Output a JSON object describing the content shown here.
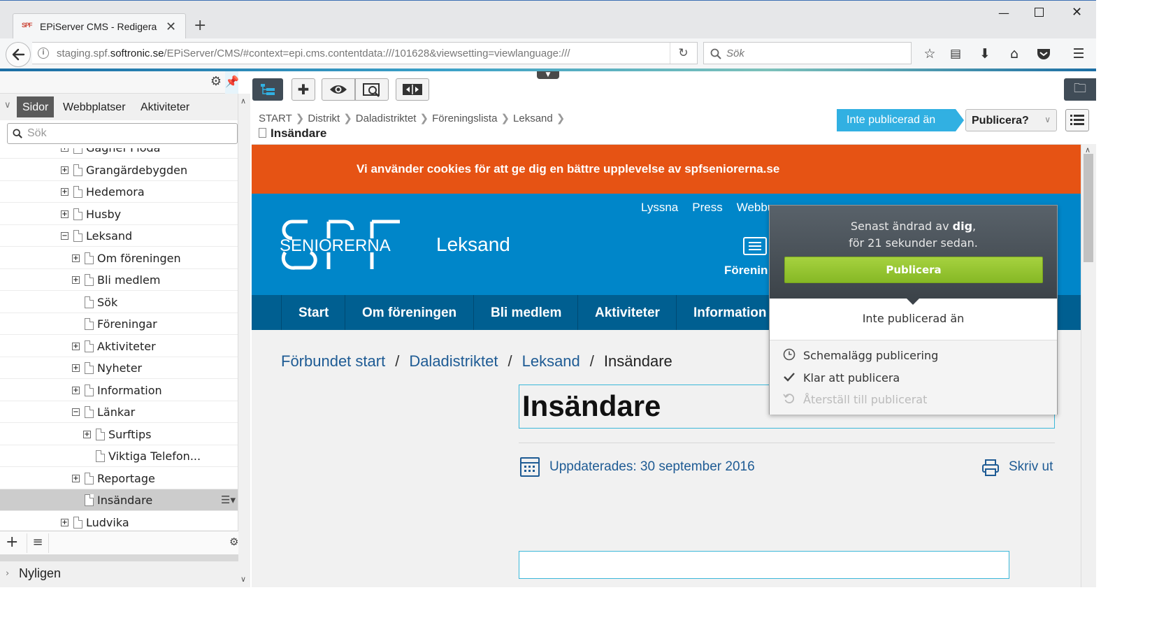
{
  "browser": {
    "tab_title": "EPiServer CMS - Redigera",
    "tab_favicon_text": "SPF",
    "url_host_prefix": "staging.spf.",
    "url_host_main": "softronic.se",
    "url_path": "/EPiServer/CMS/#context=epi.cms.contentdata:///101628&viewsetting=viewlanguage:///",
    "search_placeholder": "Sök"
  },
  "left_pane": {
    "tabs": [
      "Sidor",
      "Webbplatser",
      "Aktiviteter"
    ],
    "active_tab": "Sidor",
    "search_placeholder": "Sök",
    "tree": [
      {
        "label": "Gagnef Floda",
        "level": 0,
        "expander": "+"
      },
      {
        "label": "Grangärdebygden",
        "level": 0,
        "expander": "+"
      },
      {
        "label": "Hedemora",
        "level": 0,
        "expander": "+"
      },
      {
        "label": "Husby",
        "level": 0,
        "expander": "+"
      },
      {
        "label": "Leksand",
        "level": 0,
        "expander": "−"
      },
      {
        "label": "Om föreningen",
        "level": 1,
        "expander": "+"
      },
      {
        "label": "Bli medlem",
        "level": 1,
        "expander": "+"
      },
      {
        "label": "Sök",
        "level": 1,
        "expander": ""
      },
      {
        "label": "Föreningar",
        "level": 1,
        "expander": ""
      },
      {
        "label": "Aktiviteter",
        "level": 1,
        "expander": "+"
      },
      {
        "label": "Nyheter",
        "level": 1,
        "expander": "+"
      },
      {
        "label": "Information",
        "level": 1,
        "expander": "+"
      },
      {
        "label": "Länkar",
        "level": 1,
        "expander": "−"
      },
      {
        "label": "Surftips",
        "level": 2,
        "expander": "+"
      },
      {
        "label": "Viktiga Telefon...",
        "level": 2,
        "expander": ""
      },
      {
        "label": "Reportage",
        "level": 1,
        "expander": "+"
      },
      {
        "label": "Insändare",
        "level": 1,
        "expander": "",
        "selected": true
      },
      {
        "label": "Ludvika",
        "level": 0,
        "expander": "+"
      }
    ],
    "recent_label": "Nyligen"
  },
  "edit": {
    "breadcrumb": [
      "START",
      "Distrikt",
      "Daladistriktet",
      "Föreningslista",
      "Leksand"
    ],
    "page_title": "Insändare",
    "status_pill": "Inte publicerad än",
    "publish_button": "Publicera?"
  },
  "publish_dropdown": {
    "changed_prefix": "Senast ändrad av ",
    "changed_by": "dig",
    "changed_suffix": ",",
    "changed_time": "för 21 sekunder sedan.",
    "publish_label": "Publicera",
    "status": "Inte publicerad än",
    "items": [
      {
        "label": "Schemalägg publicering",
        "icon": "clock-icon",
        "disabled": false
      },
      {
        "label": "Klar att publicera",
        "icon": "check-icon",
        "disabled": false
      },
      {
        "label": "Återställ till publicerat",
        "icon": "undo-icon",
        "disabled": true
      }
    ]
  },
  "site": {
    "cookie_text": "Vi använder cookies för att ge dig en bättre upplevelse av spfseniorerna.se",
    "top_links": [
      "Lyssna",
      "Press",
      "Webbu"
    ],
    "logo_text": "SENIORERNA",
    "logo_letters": "SPF",
    "site_name": "Leksand",
    "foren_label": "Förenin",
    "main_nav": [
      "Start",
      "Om föreningen",
      "Bli medlem",
      "Aktiviteter",
      "Information"
    ],
    "breadcrumb": [
      "Förbundet start",
      "Daladistriktet",
      "Leksand"
    ],
    "breadcrumb_current": "Insändare",
    "heading": "Insändare",
    "updated": "Uppdaterades: 30 september 2016",
    "print_label": "Skriv ut"
  },
  "colors": {
    "accent_blue": "#31b0e2",
    "publish_green": "#94c332",
    "cookie_orange": "#e65314",
    "site_blue": "#0086c9",
    "nav_dark_blue": "#005f91"
  }
}
